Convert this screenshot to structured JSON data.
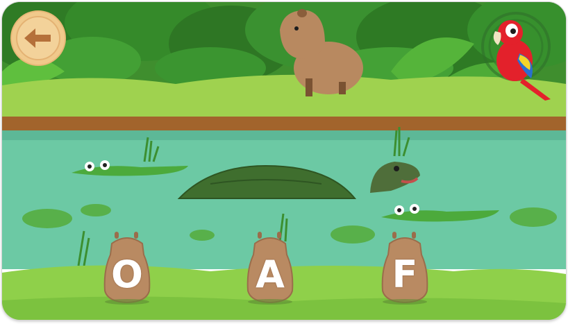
{
  "game": {
    "scene": "river",
    "controls": {
      "back_icon": "arrow-left-icon"
    },
    "colors": {
      "water": "#6cc9a4",
      "bank": "#9ed052",
      "tile": "#b98a62",
      "back_button": "#f0c98b",
      "back_arrow": "#b5703a"
    },
    "choices": [
      {
        "letter": "O"
      },
      {
        "letter": "A"
      },
      {
        "letter": "F"
      }
    ]
  }
}
